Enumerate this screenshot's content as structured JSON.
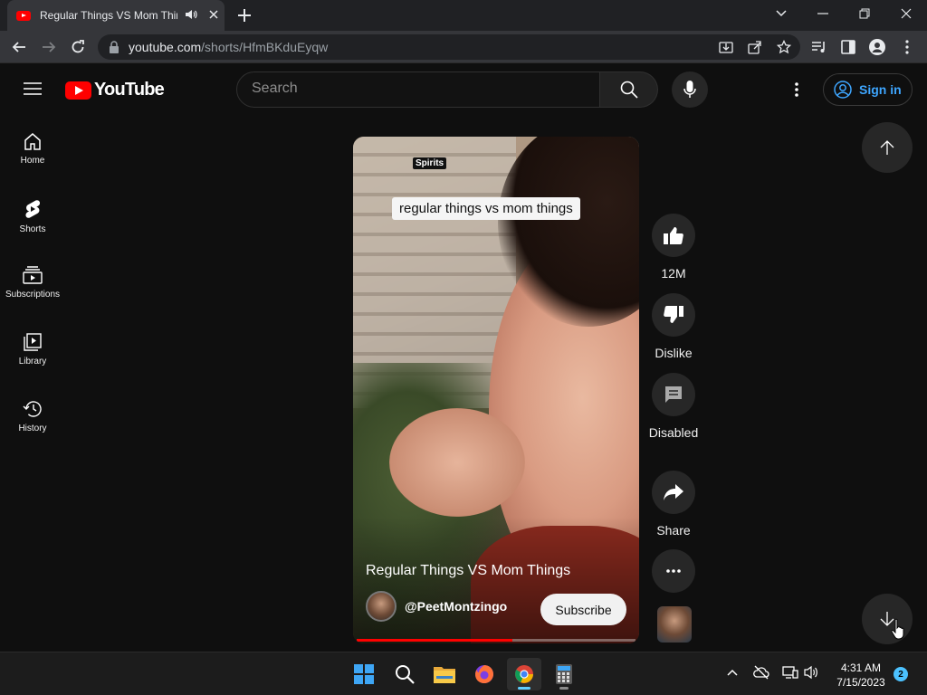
{
  "browser": {
    "tab_title": "Regular Things VS Mom Things - YouTube",
    "url_host": "youtube.com",
    "url_path": "/shorts/HfmBKduEyqw"
  },
  "masthead": {
    "logo_text": "YouTube",
    "search_placeholder": "Search",
    "signin_label": "Sign in"
  },
  "guide": {
    "items": [
      {
        "label": "Home",
        "icon": "home-icon"
      },
      {
        "label": "Shorts",
        "icon": "shorts-icon"
      },
      {
        "label": "Subscriptions",
        "icon": "subscriptions-icon"
      },
      {
        "label": "Library",
        "icon": "library-icon"
      },
      {
        "label": "History",
        "icon": "history-icon"
      }
    ]
  },
  "short": {
    "tag": "Spirits",
    "caption": "regular things vs mom things",
    "title": "Regular Things VS Mom Things",
    "channel": "@PeetMontzingo",
    "subscribe_label": "Subscribe",
    "progress": 0.56
  },
  "actions": {
    "like_count": "12M",
    "dislike_label": "Dislike",
    "comments_label": "Disabled",
    "share_label": "Share"
  },
  "taskbar": {
    "time": "4:31 AM",
    "date": "7/15/2023",
    "notification_count": "2"
  },
  "colors": {
    "accent_red": "#ff0000",
    "link_blue": "#3ea6ff",
    "background": "#0f0f0f"
  }
}
